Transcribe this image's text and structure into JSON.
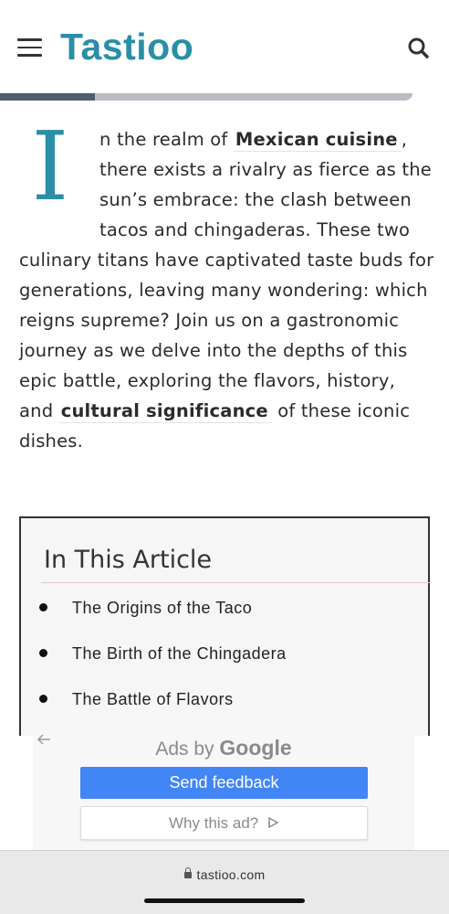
{
  "header": {
    "logo": "Tastioo",
    "menu_icon": "hamburger-menu-icon",
    "search_icon": "search-icon",
    "brand_color": "#2a8fa6"
  },
  "reading_progress": {
    "fraction": 0.23
  },
  "article": {
    "drop_cap": "I",
    "p1_a": "n the realm of ",
    "kw1": "Mexican cuisine",
    "p1_b": ", there exists a rivalry as fierce as the sun’s embrace: the clash between tacos and chingaderas. These two culinary titans have captivated taste buds for generations, leaving many wondering: which reigns supreme? Join us on a gastronomic journey as we delve into the depths of this epic battle, exploring the flavors, history, and ",
    "kw2": "cultural significance",
    "p1_c": " of these iconic dishes."
  },
  "toc": {
    "title": "In This Article",
    "items": [
      "The Origins of the Taco",
      "The Birth of the Chingadera",
      "The Battle of Flavors"
    ]
  },
  "ad": {
    "back_icon": "back-arrow-icon",
    "ads_by": "Ads by",
    "google": "Google",
    "send_feedback": "Send feedback",
    "why_this_ad": "Why this ad?",
    "adchoices_icon": "adchoices-icon",
    "button_color": "#4285f4"
  },
  "browser": {
    "url": "tastioo.com",
    "lock_icon": "lock-icon"
  }
}
